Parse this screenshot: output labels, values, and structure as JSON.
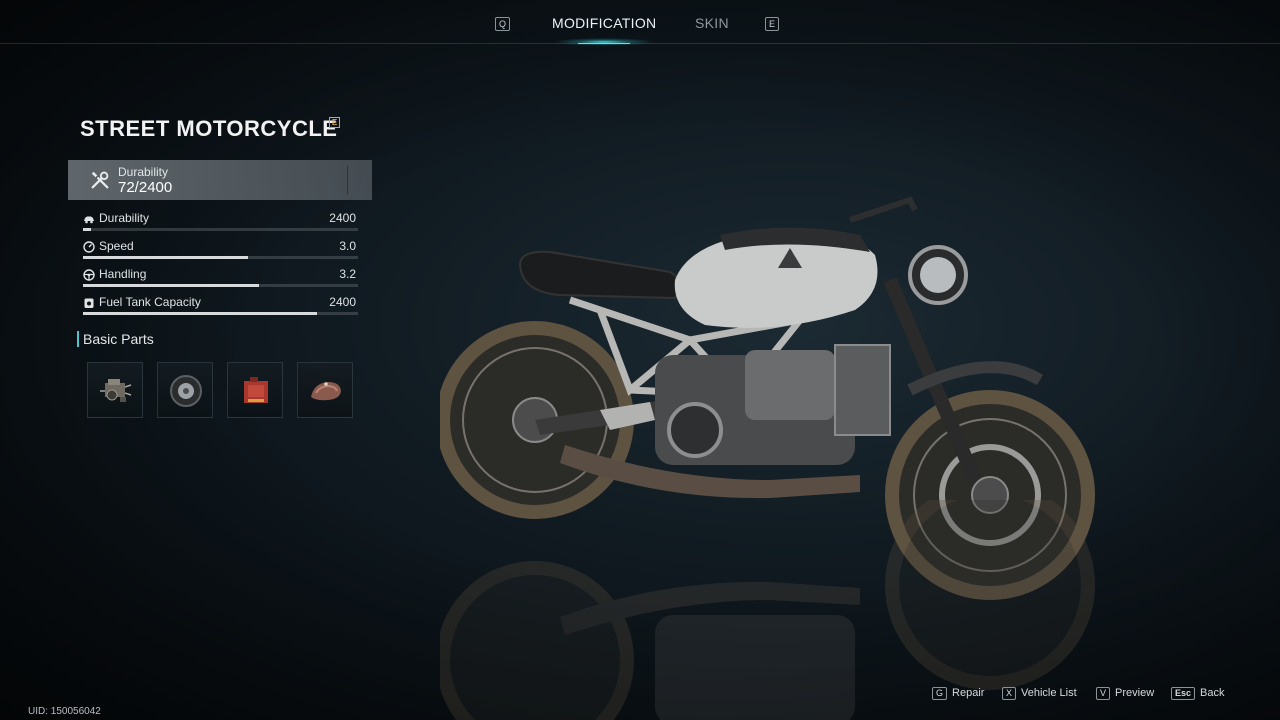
{
  "nav": {
    "prev_key": "Q",
    "next_key": "E",
    "tabs": [
      {
        "label": "MODIFICATION",
        "active": true
      },
      {
        "label": "SKIN",
        "active": false
      }
    ]
  },
  "vehicle": {
    "name": "STREET MOTORCYCLE",
    "rarity_badge": "E",
    "durability_label": "Durability",
    "durability_value": "72/2400"
  },
  "stats": [
    {
      "label": "Durability",
      "value": "2400",
      "icon": "car-icon",
      "fill": 0.03
    },
    {
      "label": "Speed",
      "value": "3.0",
      "icon": "speedometer-icon",
      "fill": 0.6
    },
    {
      "label": "Handling",
      "value": "3.2",
      "icon": "steering-wheel-icon",
      "fill": 0.64
    },
    {
      "label": "Fuel Tank Capacity",
      "value": "2400",
      "icon": "fuel-icon",
      "fill": 0.85
    }
  ],
  "parts": {
    "title": "Basic Parts",
    "items": [
      {
        "icon": "engine-part-icon"
      },
      {
        "icon": "tire-part-icon"
      },
      {
        "icon": "fuel-can-part-icon"
      },
      {
        "icon": "fuel-tank-part-icon"
      }
    ]
  },
  "footer": {
    "uid": "UID: 150056042",
    "hints": [
      {
        "key": "G",
        "label": "Repair"
      },
      {
        "key": "X",
        "label": "Vehicle List"
      },
      {
        "key": "V",
        "label": "Preview"
      },
      {
        "key": "Esc",
        "label": "Back"
      }
    ]
  },
  "colors": {
    "accent": "#5fe9ea",
    "rarity": "#d6a64a",
    "bar_fill": "#d7dadc"
  }
}
